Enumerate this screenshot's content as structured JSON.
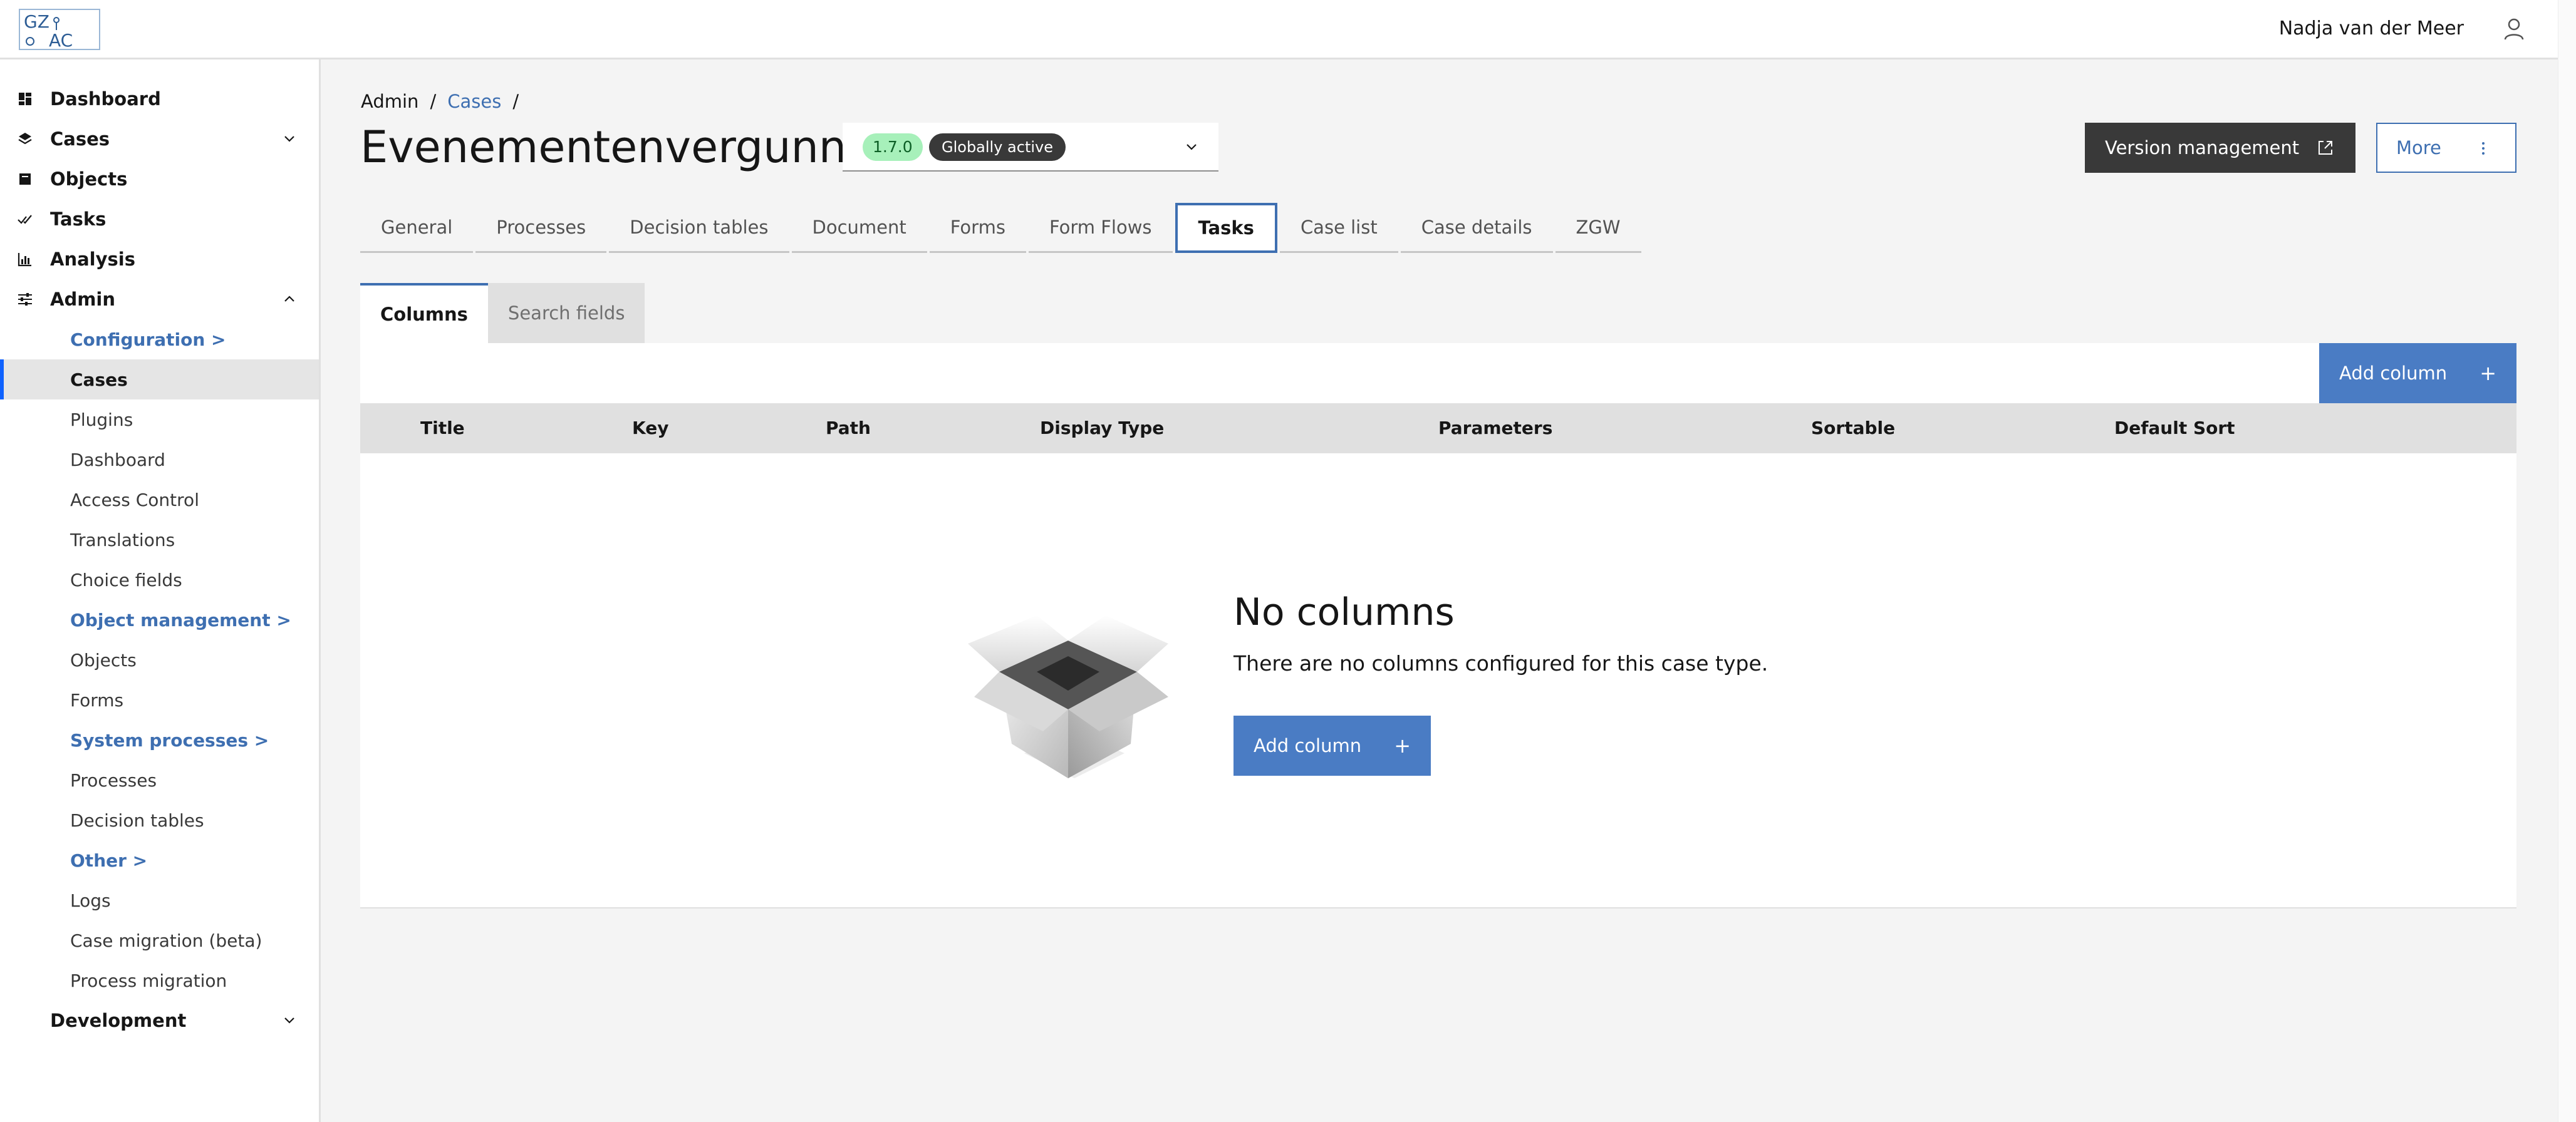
{
  "header": {
    "logo_text_top": "GZ",
    "logo_text_bottom": "AC",
    "user_name": "Nadja van der Meer"
  },
  "sidebar": {
    "items": [
      {
        "label": "Dashboard",
        "icon": "dashboard-icon"
      },
      {
        "label": "Cases",
        "icon": "layers-icon",
        "expandable": "collapsed"
      },
      {
        "label": "Objects",
        "icon": "objects-icon"
      },
      {
        "label": "Tasks",
        "icon": "checkmark-icon"
      },
      {
        "label": "Analysis",
        "icon": "chart-icon"
      },
      {
        "label": "Admin",
        "icon": "settings-adjust-icon",
        "expandable": "expanded"
      }
    ],
    "admin_sub": [
      {
        "label": "Configuration >",
        "type": "section"
      },
      {
        "label": "Cases",
        "type": "active"
      },
      {
        "label": "Plugins"
      },
      {
        "label": "Dashboard"
      },
      {
        "label": "Access Control"
      },
      {
        "label": "Translations"
      },
      {
        "label": "Choice fields"
      },
      {
        "label": "Object management >",
        "type": "section"
      },
      {
        "label": "Objects"
      },
      {
        "label": "Forms"
      },
      {
        "label": "System processes >",
        "type": "section"
      },
      {
        "label": "Processes"
      },
      {
        "label": "Decision tables"
      },
      {
        "label": "Other >",
        "type": "section"
      },
      {
        "label": "Logs"
      },
      {
        "label": "Case migration (beta)"
      },
      {
        "label": "Process migration"
      }
    ],
    "development": {
      "label": "Development",
      "expandable": "collapsed"
    }
  },
  "breadcrumb": {
    "root": "Admin",
    "link": "Cases",
    "separator": "/"
  },
  "page": {
    "title": "Evenementenvergunning",
    "version": "1.7.0",
    "version_status": "Globally active",
    "version_management_label": "Version management",
    "more_label": "More"
  },
  "tabs": [
    "General",
    "Processes",
    "Decision tables",
    "Document",
    "Forms",
    "Form Flows",
    "Tasks",
    "Case list",
    "Case details",
    "ZGW"
  ],
  "active_tab": "Tasks",
  "subtabs": [
    "Columns",
    "Search fields"
  ],
  "active_subtab": "Columns",
  "table": {
    "add_column_label": "Add column",
    "columns": [
      "Title",
      "Key",
      "Path",
      "Display Type",
      "Parameters",
      "Sortable",
      "Default Sort"
    ]
  },
  "empty_state": {
    "title": "No columns",
    "description": "There are no columns configured for this case type.",
    "button_label": "Add column"
  },
  "colors": {
    "accent": "#3e6fb1",
    "primary_button": "#4a7cc4",
    "dark_button": "#393939",
    "version_tag_bg": "#a7f0ba"
  }
}
